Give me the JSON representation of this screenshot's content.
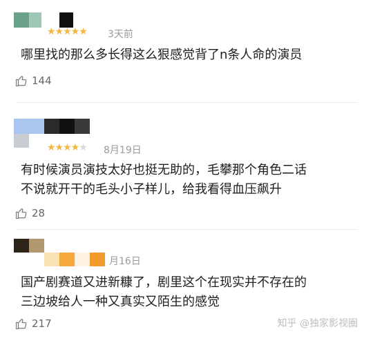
{
  "reviews": [
    {
      "stars": "★★★★★",
      "date": "3天前",
      "text": "哪里找的那么多长得这么狠感觉背了n条人命的演员",
      "likes": "144"
    },
    {
      "stars": "★★★★",
      "empty_stars": "★",
      "date": "8月19日",
      "text_line1": "有时候演员演技太好也挺无助的，毛攀那个角色二话",
      "text_line2": "不说就开干的毛头小子样儿，给我看得血压飙升",
      "likes": "28"
    },
    {
      "date": "月16日",
      "text_line1": "国产剧赛道又进新糠了，剧里这个在现实并不存在的",
      "text_line2": "三边坡给人一种又真实又陌生的感觉",
      "likes": "217"
    }
  ],
  "watermark": "知乎 @独家影视圈",
  "colors": {
    "star": "#f5b642",
    "text": "#1e1e1e",
    "meta": "#9a9a9a"
  },
  "icons": {
    "like": "thumbs-up-icon"
  }
}
